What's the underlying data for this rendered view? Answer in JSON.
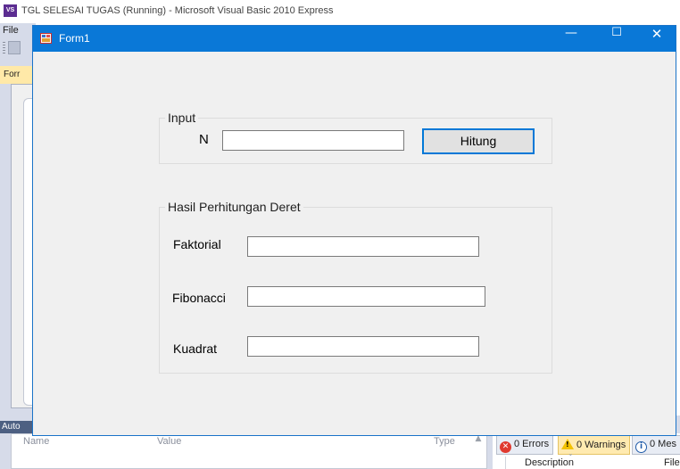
{
  "ide": {
    "logo_text": "VS",
    "title": "TGL SELESAI TUGAS (Running) - Microsoft Visual Basic 2010 Express",
    "menu_file": "File",
    "doc_tab": "Forr",
    "autos_tab": "Auto",
    "autos_columns": [
      "Name",
      "Value",
      "Type"
    ],
    "error_list": {
      "errors_label": "0 Errors",
      "warnings_label": "0 Warnings",
      "messages_label": "0 Mes",
      "columns": [
        "Description",
        "File"
      ]
    }
  },
  "form": {
    "title": "Form1",
    "window_controls": {
      "minimize": "—",
      "maximize": "☐",
      "close": "✕"
    },
    "input_group": {
      "legend": "Input",
      "n_label": "N",
      "n_value": "",
      "button_label": "Hitung"
    },
    "result_group": {
      "legend": "Hasil Perhitungan Deret",
      "faktorial_label": "Faktorial",
      "faktorial_value": "",
      "fibonacci_label": "Fibonacci",
      "fibonacci_value": "",
      "kuadrat_label": "Kuadrat",
      "kuadrat_value": ""
    }
  },
  "colors": {
    "titlebar": "#0a78d7",
    "form_background": "#f0f0f0",
    "button_focus_border": "#0078d7",
    "ide_chrome": "#d6dbe9"
  }
}
